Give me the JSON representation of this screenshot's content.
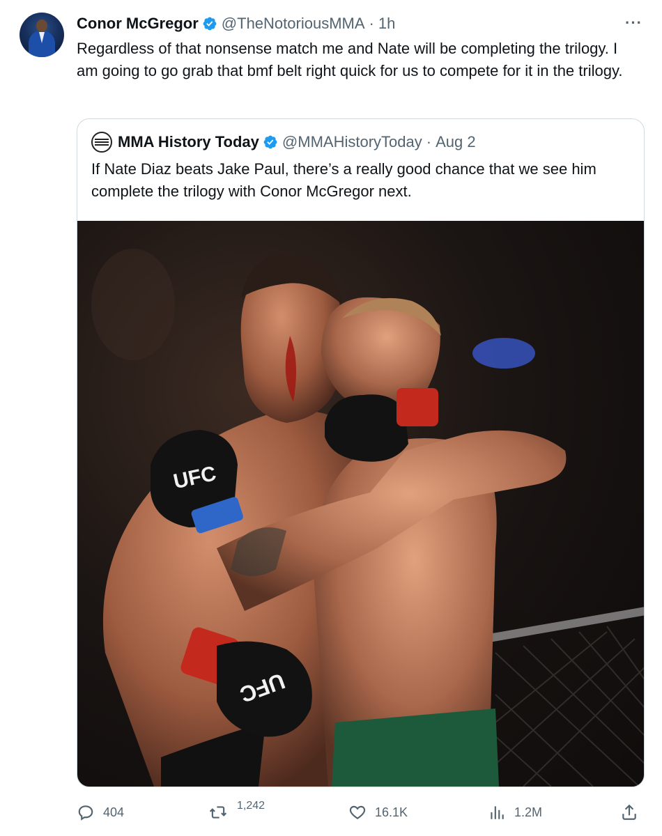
{
  "tweet": {
    "author_name": "Conor McGregor",
    "author_handle": "@TheNotoriousMMA",
    "separator": "·",
    "time": "1h",
    "more_label": "···",
    "text": "Regardless of that nonsense match me and Nate will be completing the trilogy. I am going to go grab that bmf belt right quick for us to compete for it in the trilogy."
  },
  "quote": {
    "author_name": "MMA History Today",
    "author_handle": "@MMAHistoryToday",
    "separator": "·",
    "time": "Aug 2",
    "text": "If Nate Diaz beats Jake Paul, there’s a really good chance that we see him complete the trilogy with Conor McGregor next.",
    "image_alt": "Two UFC fighters embracing in the octagon",
    "glove_text_left": "UFC",
    "glove_text_right": "UFC"
  },
  "actions": {
    "replies": "404",
    "retweets": "1,242",
    "likes": "16.1K",
    "views": "1.2M"
  },
  "colors": {
    "text_primary": "#0f1419",
    "text_secondary": "#536471",
    "verified": "#1d9bf0",
    "border": "#cfd9de"
  }
}
